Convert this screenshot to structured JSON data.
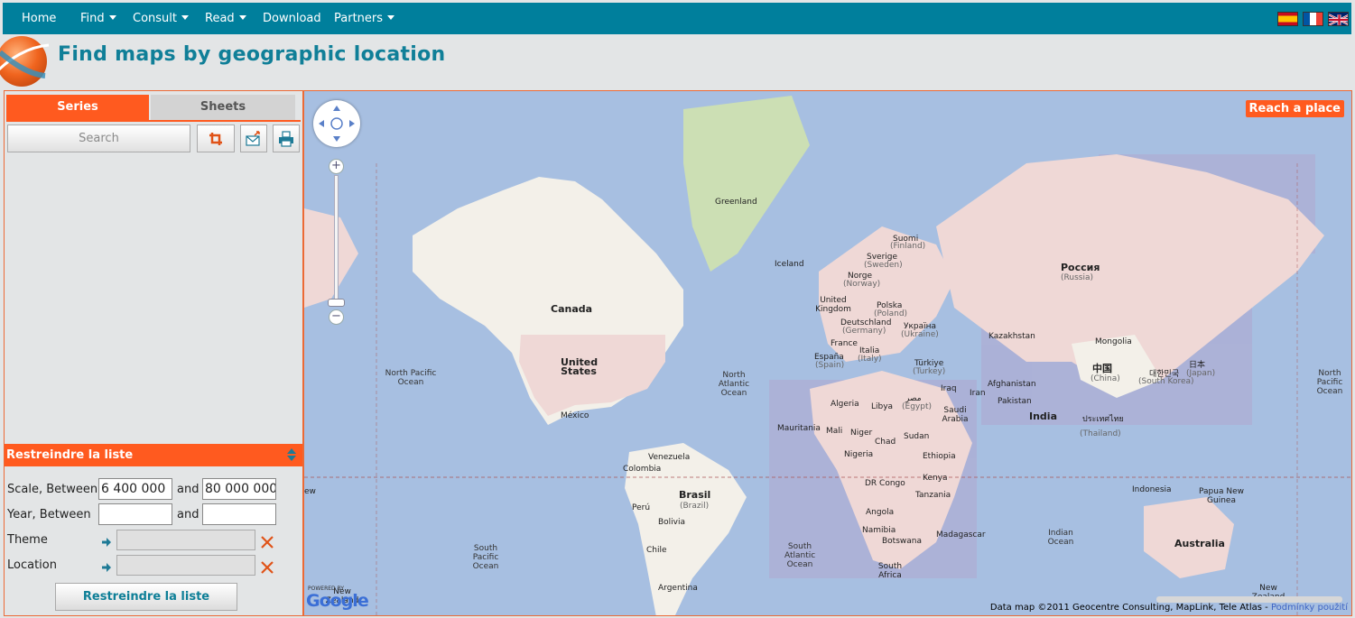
{
  "nav": {
    "items": [
      {
        "label": "Home",
        "dropdown": false
      },
      {
        "label": "Find",
        "dropdown": true
      },
      {
        "label": "Consult",
        "dropdown": true
      },
      {
        "label": "Read",
        "dropdown": true
      },
      {
        "label": "Download",
        "dropdown": false
      },
      {
        "label": "Partners",
        "dropdown": true
      }
    ],
    "languages": [
      "es-flag-icon",
      "fr-flag-icon",
      "uk-flag-icon"
    ]
  },
  "header": {
    "title": "Find maps by geographic location"
  },
  "sidebar": {
    "tabs": [
      {
        "label": "Series",
        "active": true
      },
      {
        "label": "Sheets",
        "active": false
      }
    ],
    "search_label": "Search",
    "tools": [
      "crop-icon",
      "mail-icon",
      "print-icon"
    ],
    "restrict": {
      "title": "Restreindre la liste",
      "scale_label": "Scale, Between",
      "scale_min": "6 400 000",
      "scale_max": "80 000 000",
      "and_label": "and",
      "year_label": "Year, Between",
      "year_min": "",
      "year_max": "",
      "theme_label": "Theme",
      "location_label": "Location",
      "submit_label": "Restreindre la liste"
    }
  },
  "map": {
    "reach_label": "Reach a place",
    "labels": {
      "greenland": "Greenland",
      "iceland": "Iceland",
      "canada": "Canada",
      "united_states": "United States",
      "mexico": "México",
      "north_pacific_ocean": "North Pacific Ocean",
      "north_atlantic_ocean": "North Atlantic Ocean",
      "south_pacific_ocean": "South Pacific Ocean",
      "south_atlantic_ocean": "South Atlantic Ocean",
      "indian_ocean": "Indian Ocean",
      "north_pacific_ocean_east": "North Pacific Ocean",
      "venezuela": "Venezuela",
      "colombia": "Colombia",
      "brasil": "Brasil",
      "brasil_en": "(Brazil)",
      "peru": "Perú",
      "bolivia": "Bolivia",
      "chile": "Chile",
      "argentina": "Argentina",
      "suomi": "Suomi",
      "suomi_en": "(Finland)",
      "sverige": "Sverige",
      "sverige_en": "(Sweden)",
      "norge": "Norge",
      "norge_en": "(Norway)",
      "uk": "United Kingdom",
      "polska": "Polska",
      "polska_en": "(Poland)",
      "deutschland": "Deutschland",
      "deutschland_en": "(Germany)",
      "ukraine": "Україна",
      "ukraine_en": "(Ukraine)",
      "france": "France",
      "espana": "España",
      "espana_en": "(Spain)",
      "italia": "Italia",
      "italia_en": "(Italy)",
      "turkey": "Türkiye",
      "turkey_en": "(Turkey)",
      "russia": "Россия",
      "russia_en": "(Russia)",
      "kazakhstan": "Kazakhstan",
      "mongolia": "Mongolia",
      "china": "中国",
      "china_en": "(China)",
      "japan": "日本",
      "japan_en": "(Japan)",
      "korea": "대한민국",
      "korea_en": "(South Korea)",
      "iraq": "Iraq",
      "iran": "Iran",
      "afghanistan": "Afghanistan",
      "pakistan": "Pakistan",
      "india": "India",
      "thailand": "ประเทศไทย",
      "thailand_en": "(Thailand)",
      "algeria": "Algeria",
      "libya": "Libya",
      "egypt": "مصر",
      "egypt_en": "(Egypt)",
      "saudi_arabia": "Saudi Arabia",
      "mauritania": "Mauritania",
      "mali": "Mali",
      "niger": "Niger",
      "chad": "Chad",
      "sudan": "Sudan",
      "nigeria": "Nigeria",
      "ethiopia": "Ethiopia",
      "kenya": "Kenya",
      "dr_congo": "DR Congo",
      "tanzania": "Tanzania",
      "angola": "Angola",
      "namibia": "Namibia",
      "botswana": "Botswana",
      "madagascar": "Madagascar",
      "south_africa": "South Africa",
      "indonesia": "Indonesia",
      "papua_new_guinea": "Papua New Guinea",
      "australia": "Australia",
      "new_zealand": "New Zealand",
      "new_zealand_east": "New Zealand",
      "partial_left": "ew"
    },
    "powered_by": "POWERED BY",
    "google": "Google",
    "credits": "Data map ©2011 Geocentre Consulting, MapLink, Tele Atlas -",
    "terms_link": "Podmínky použití"
  }
}
